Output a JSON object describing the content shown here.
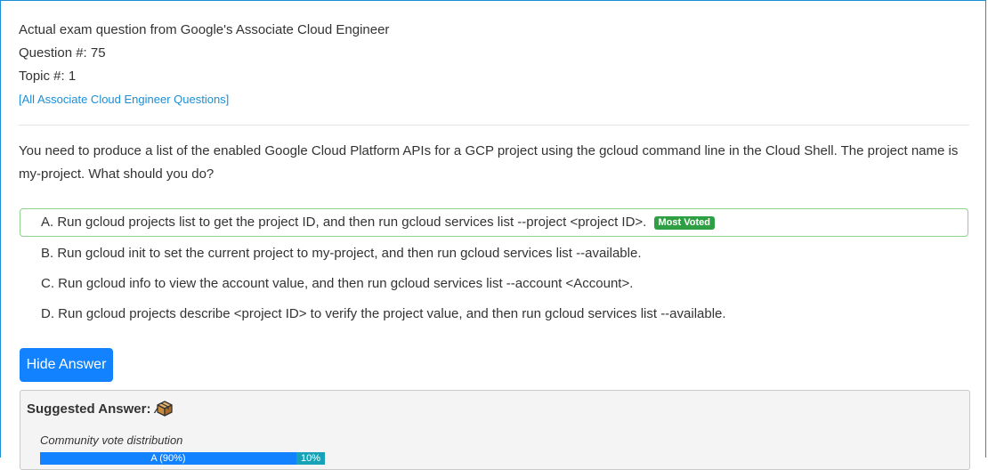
{
  "header": {
    "exam_line": "Actual exam question from Google's Associate Cloud Engineer",
    "question_number": "Question #: 75",
    "topic": "Topic #: 1",
    "all_questions_link": "[All Associate Cloud Engineer Questions]"
  },
  "question": {
    "text": "You need to produce a list of the enabled Google Cloud Platform APIs for a GCP project using the gcloud command line in the Cloud Shell. The project name is my-project. What should you do?"
  },
  "choices": [
    {
      "text": "A. Run gcloud projects list to get the project ID, and then run gcloud services list --project <project ID>.",
      "badge": "Most Voted"
    },
    {
      "text": "B. Run gcloud init to set the current project to my-project, and then run gcloud services list --available."
    },
    {
      "text": "C. Run gcloud info to view the account value, and then run gcloud services list --account <Account>."
    },
    {
      "text": "D. Run gcloud projects describe <project ID> to verify the project value, and then run gcloud services list --available."
    }
  ],
  "hide_answer_button": "Hide Answer",
  "answer": {
    "label": "Suggested Answer:",
    "value": "A",
    "icon": "box-icon",
    "distribution_label": "Community vote distribution",
    "votes": [
      {
        "label": "A (90%)",
        "percent": 90,
        "color": "#1282ff"
      },
      {
        "label": "10%",
        "percent": 10,
        "color": "#17a2b8"
      }
    ]
  },
  "colors": {
    "accent": "#1282ff",
    "link": "#1a8fd6",
    "most_voted_badge": "#2ea043",
    "correct_border": "#8fd18f"
  }
}
